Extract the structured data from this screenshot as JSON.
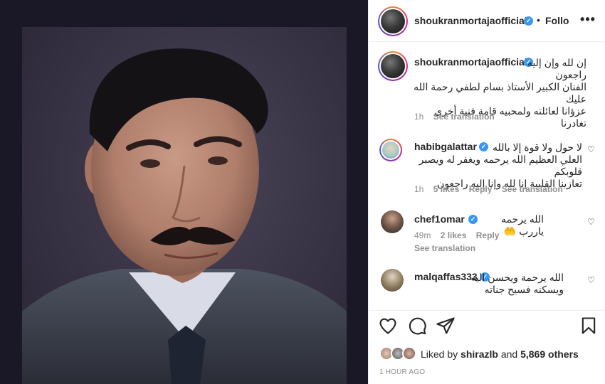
{
  "post": {
    "author": "shoukranmortajaofficial",
    "follow_label": "Follo",
    "dot": "•",
    "more_icon": "more-horizontal-icon"
  },
  "caption": {
    "username": "shoukranmortajaofficial",
    "lines": [
      "إن لله وإن إليه",
      "راجعون",
      "الفنان الكبير الأستاذ بسام لطفي رحمة الله عليك",
      "عزؤانا لعائلته ولمحبيه قامة فنية أخرى تغادرنا"
    ],
    "time": "1h",
    "see_translation": "See translation"
  },
  "comments": [
    {
      "username": "habibgalattar",
      "lines": [
        "لا حول ولا قوة إلا بالله",
        "العلي العظيم الله يرحمه ويغفر له ويصبر قلوبكم",
        "تعازينا القلبية إنا لله وإنا إليه راجعون"
      ],
      "time": "1h",
      "likes": "5 likes",
      "reply": "Reply",
      "see_translation": "See translation"
    },
    {
      "username": "chef1omar",
      "lines": [
        "الله يرحمه ياررب 🤲"
      ],
      "time": "49m",
      "likes": "2 likes",
      "reply": "Reply",
      "see_translation": "See translation"
    },
    {
      "username": "malqaffas333",
      "lines": [
        "الله يرحمة ويحسن اليه",
        "ويسكنه فسيح جناته"
      ]
    }
  ],
  "likes": {
    "prefix": "Liked by",
    "user": "shirazlb",
    "and": "and",
    "others": "5,869 others"
  },
  "timestamp": "1 HOUR AGO",
  "colors": {
    "verified": "#3897f0",
    "muted": "#8e8e8e",
    "text": "#262626",
    "media_bg": "#1a1826"
  }
}
